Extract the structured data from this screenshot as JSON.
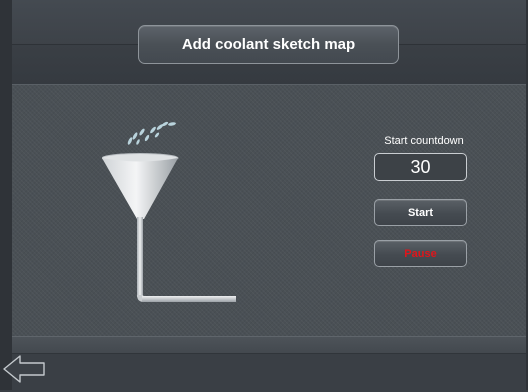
{
  "header": {
    "title": "Add coolant sketch map"
  },
  "countdown": {
    "label": "Start countdown",
    "value": "30"
  },
  "controls": {
    "start_label": "Start",
    "pause_label": "Pause"
  },
  "icons": {
    "back": "back-arrow-icon",
    "funnel": "funnel-illustration"
  },
  "colors": {
    "background": "#4a5055",
    "pause_text": "#e0151b",
    "text": "#ffffff"
  }
}
